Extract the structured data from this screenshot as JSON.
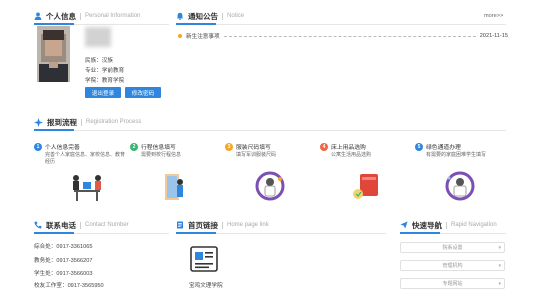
{
  "personal": {
    "title": "个人信息",
    "title_en": "Personal Information",
    "ethnicity": "民族：汉族",
    "major": "专业：学前教育",
    "college": "学院：教育学院",
    "logout_label": "退出登录",
    "change_password_label": "修改密码"
  },
  "notice": {
    "title": "通知公告",
    "title_en": "Notice",
    "more_label": "more>>",
    "items": [
      {
        "title": "新生注意事项",
        "date": "2021-11-15"
      }
    ]
  },
  "process": {
    "title": "报到流程",
    "title_en": "Registration Process",
    "steps": [
      {
        "num": "1",
        "title": "个人信息完善",
        "desc": "完善个人家庭信息、家校信息、教育经历",
        "color": "#2e86de"
      },
      {
        "num": "2",
        "title": "行程信息填写",
        "desc": "需要到校行程信息",
        "color": "#3cb371"
      },
      {
        "num": "3",
        "title": "服装尺码填写",
        "desc": "填写军训服装尺码",
        "color": "#f5a623"
      },
      {
        "num": "4",
        "title": "床上用品选购",
        "desc": "公寓生活用品选购",
        "color": "#f06543"
      },
      {
        "num": "5",
        "title": "绿色通道办理",
        "desc": "有需要的家庭困难学生填写",
        "color": "#2e86de"
      }
    ]
  },
  "contact": {
    "title": "联系电话",
    "title_en": "Contact Number",
    "lines": [
      "综合处：0917-3361065",
      "教务处：0917-3566207",
      "学生处：0917-3566003",
      "校友工作室：0917-3565950"
    ]
  },
  "links": {
    "title": "首页链接",
    "title_en": "Home page link",
    "item_label": "宝鸡文理学院"
  },
  "quicknav": {
    "title": "快速导航",
    "title_en": "Rapid Navigation",
    "items": [
      "院系设置",
      "管理机构",
      "专题网站"
    ]
  },
  "colors": {
    "accent": "#2e86de",
    "notice_dot": "#f5a623"
  }
}
